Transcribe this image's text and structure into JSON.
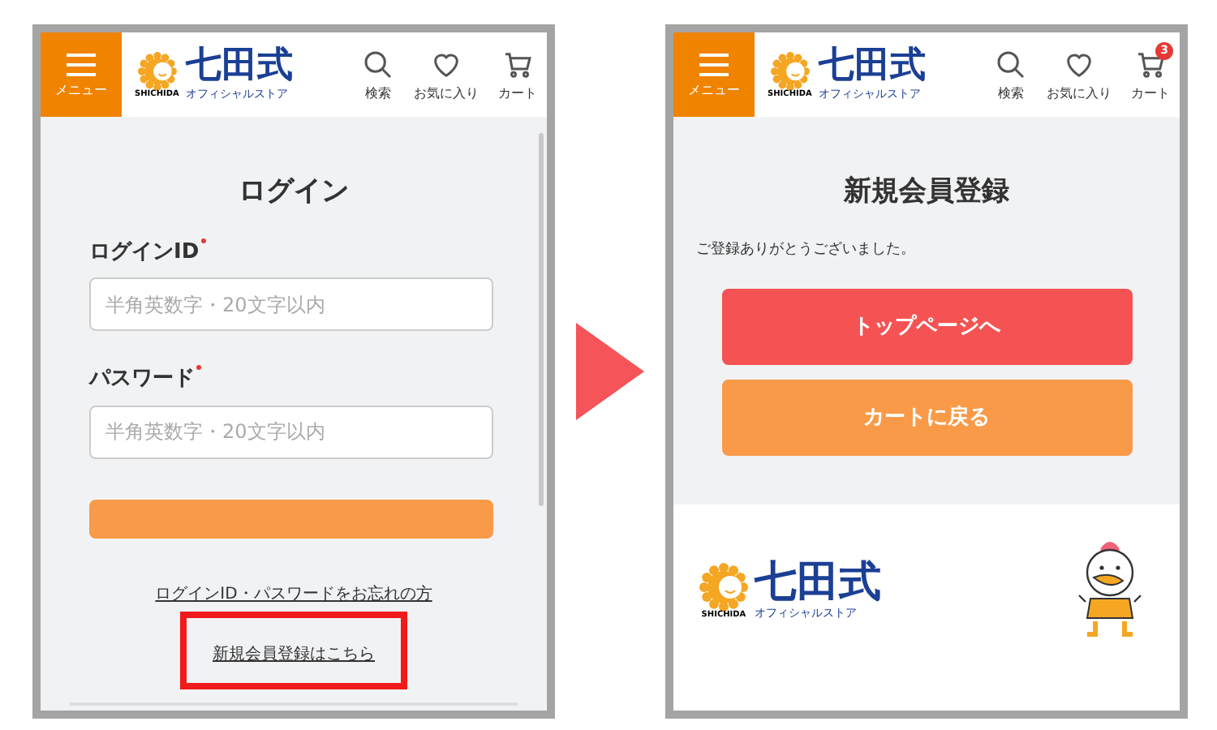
{
  "left_screen": {
    "header": {
      "menu_label": "メニュー",
      "logo": {
        "brand": "七田式",
        "tagline": "オフィシャルストア",
        "mark_text": "SHICHIDA"
      },
      "nav": [
        {
          "kind": "search",
          "label": "検索"
        },
        {
          "kind": "heart",
          "label": "お気に入り"
        },
        {
          "kind": "cart",
          "label": "カート"
        }
      ]
    },
    "title": "ログイン",
    "fields": [
      {
        "label": "ログインID",
        "required": true,
        "placeholder": "半角英数字・20文字以内"
      },
      {
        "label": "パスワード",
        "required": true,
        "placeholder": "半角英数字・20文字以内"
      }
    ],
    "links": [
      {
        "label": "ログインID・パスワードをお忘れの方",
        "highlighted": false
      },
      {
        "label": "新規会員登録はこちら",
        "highlighted": true
      }
    ]
  },
  "right_screen": {
    "header": {
      "menu_label": "メニュー",
      "logo": {
        "brand": "七田式",
        "tagline": "オフィシャルストア",
        "mark_text": "SHICHIDA"
      },
      "nav": [
        {
          "kind": "search",
          "label": "検索"
        },
        {
          "kind": "heart",
          "label": "お気に入り"
        },
        {
          "kind": "cart",
          "label": "カート",
          "badge": "3"
        }
      ]
    },
    "title": "新規会員登録",
    "message": "ご登録ありがとうございました。",
    "buttons": [
      {
        "kind": "primary",
        "label": "トップページへ"
      },
      {
        "kind": "secondary",
        "label": "カートに戻る"
      }
    ],
    "footer_logo": {
      "brand": "七田式",
      "tagline": "オフィシャルストア",
      "mark_text": "SHICHIDA"
    }
  }
}
